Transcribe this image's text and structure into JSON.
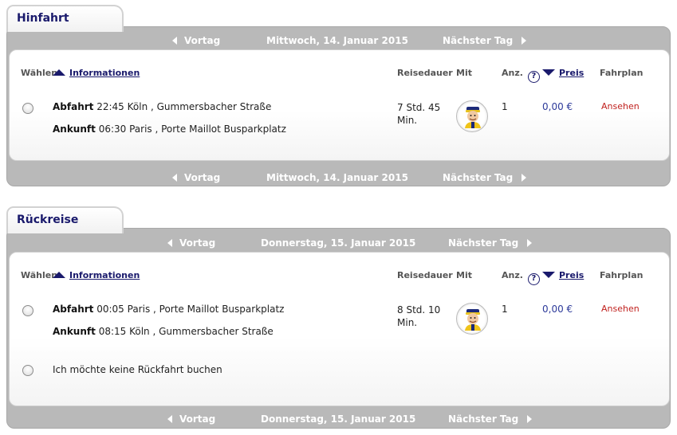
{
  "outbound": {
    "tab_label": "Hinfahrt",
    "nav": {
      "prev": "Vortag",
      "date": "Mittwoch, 14. Januar 2015",
      "next": "Nächster Tag"
    },
    "headers": {
      "select": "Wählen",
      "info": "Informationen",
      "duration": "Reisedauer",
      "with": "Mit",
      "count": "Anz.",
      "help": "?",
      "price": "Preis",
      "timetable": "Fahrplan"
    },
    "trip": {
      "dep_label": "Abfahrt",
      "dep_text": "22:45 Köln , Gummersbacher Straße",
      "arr_label": "Ankunft",
      "arr_text": "06:30 Paris , Porte Maillot Busparkplatz",
      "duration_line1": "7 Std. 45",
      "duration_line2": "Min.",
      "count": "1",
      "price": "0,00 €",
      "timetable_link": "Ansehen"
    }
  },
  "return": {
    "tab_label": "Rückreise",
    "nav": {
      "prev": "Vortag",
      "date": "Donnerstag, 15. Januar 2015",
      "next": "Nächster Tag"
    },
    "headers": {
      "select": "Wählen",
      "info": "Informationen",
      "duration": "Reisedauer",
      "with": "Mit",
      "count": "Anz.",
      "help": "?",
      "price": "Preis",
      "timetable": "Fahrplan"
    },
    "trip": {
      "dep_label": "Abfahrt",
      "dep_text": "00:05 Paris , Porte Maillot Busparkplatz",
      "arr_label": "Ankunft",
      "arr_text": "08:15 Köln , Gummersbacher Straße",
      "duration_line1": "8 Std. 10",
      "duration_line2": "Min.",
      "count": "1",
      "price": "0,00 €",
      "timetable_link": "Ansehen"
    },
    "no_return_label": "Ich möchte keine Rückfahrt buchen"
  },
  "colors": {
    "accent": "#1a1a6c",
    "bar": "#b9b9b9",
    "price": "#2d3a9a",
    "link_red": "#c0211e"
  },
  "icons": {
    "driver": "bus-driver-mascot-icon"
  }
}
